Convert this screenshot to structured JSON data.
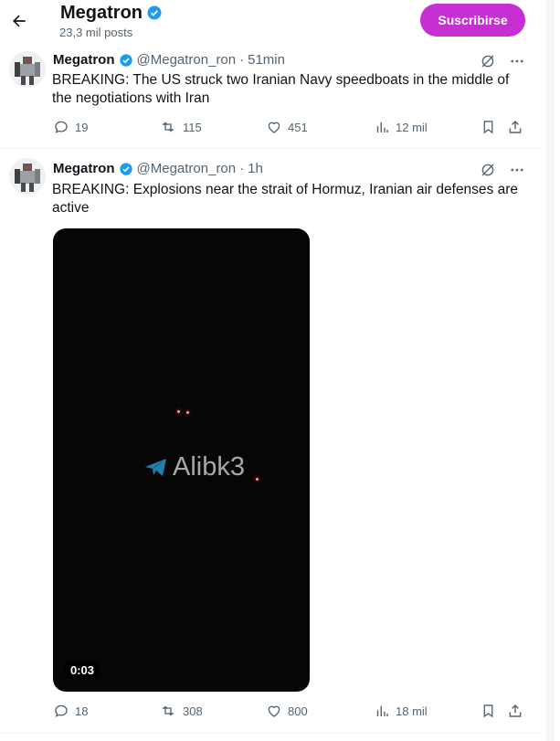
{
  "header": {
    "name": "Megatron",
    "post_count": "23,3 mil posts",
    "subscribe_label": "Suscribirse"
  },
  "colors": {
    "verified": "#1d9bf0",
    "subscribe": "#c62fd1",
    "muted": "#536471"
  },
  "tweets": [
    {
      "name": "Megatron",
      "handle": "@Megatron_ron",
      "separator": "·",
      "time": "51min",
      "text": "BREAKING: The US struck two Iranian Navy speedboats in the middle of the negotiations with Iran",
      "replies": "19",
      "reposts": "115",
      "likes": "451",
      "views": "12 mil"
    },
    {
      "name": "Megatron",
      "handle": "@Megatron_ron",
      "separator": "·",
      "time": "1h",
      "text": "BREAKING: Explosions near the strait of Hormuz, Iranian air defenses are active",
      "replies": "18",
      "reposts": "308",
      "likes": "800",
      "views": "18 mil",
      "media": {
        "watermark": "Alibk3",
        "duration": "0:03"
      }
    }
  ],
  "icons": [
    "back-arrow-icon",
    "verified-badge-icon",
    "grok-icon",
    "more-icon",
    "reply-icon",
    "repost-icon",
    "like-icon",
    "views-icon",
    "bookmark-icon",
    "share-icon",
    "telegram-icon"
  ]
}
